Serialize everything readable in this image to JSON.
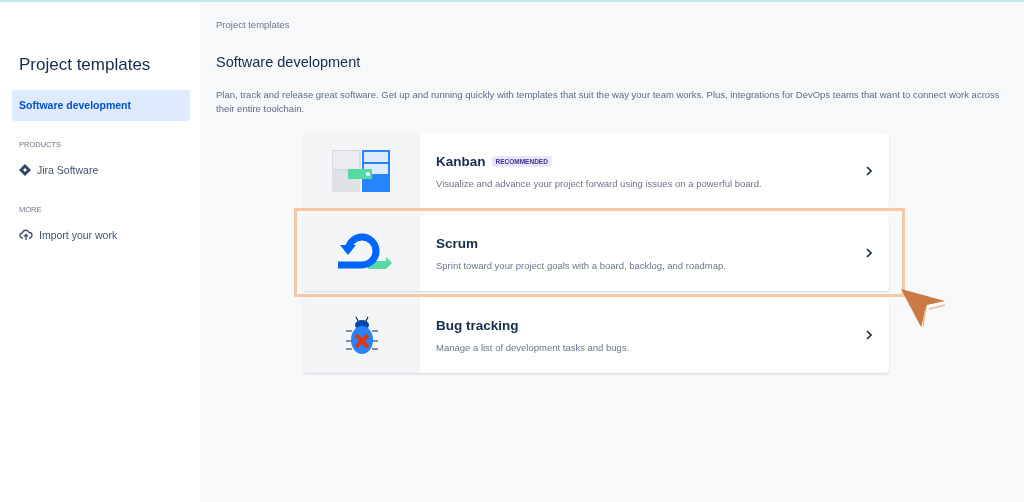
{
  "sidebar": {
    "title": "Project templates",
    "items": [
      {
        "label": "Software development",
        "selected": true
      }
    ],
    "sections": [
      {
        "heading": "PRODUCTS",
        "items": [
          {
            "label": "Jira Software",
            "kind": "diamond"
          }
        ]
      },
      {
        "heading": "MORE",
        "items": [
          {
            "label": "Import your work",
            "kind": "cloud"
          }
        ]
      }
    ]
  },
  "main": {
    "breadcrumb": "Project templates",
    "title": "Software development",
    "description": "Plan, track and release great software. Get up and running quickly with templates that suit the way your team works. Plus, integrations for DevOps teams that want to connect work across their entire toolchain.",
    "templates": [
      {
        "kind": "kanban",
        "name": "Kanban",
        "badge": "RECOMMENDED",
        "description": "Visualize and advance your project forward using issues on a powerful board.",
        "highlighted": false
      },
      {
        "kind": "scrum",
        "name": "Scrum",
        "description": "Sprint toward your project goals with a board, backlog, and roadmap.",
        "highlighted": true
      },
      {
        "kind": "bug",
        "name": "Bug tracking",
        "description": "Manage a list of development tasks and bugs.",
        "highlighted": false
      }
    ]
  }
}
